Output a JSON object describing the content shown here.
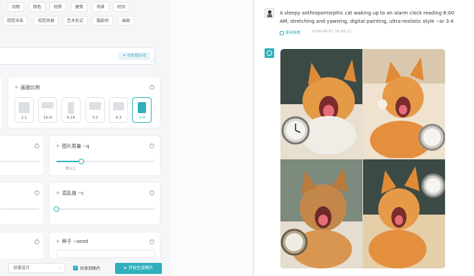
{
  "left": {
    "tag_rows": [
      [
        "动物",
        "颜色",
        "材质",
        "建筑",
        "场景",
        "时间"
      ],
      [
        "视觉冲击",
        "视觉风格",
        "艺术形式",
        "摄影师",
        "画家"
      ]
    ],
    "prompt_input": {
      "value": "",
      "optimize_label": "✦ 优化提示词"
    },
    "aspect_ratio": {
      "title": "画面比例",
      "options": [
        "1:1",
        "16:9",
        "9:16",
        "3:2",
        "4:3",
        "3:4"
      ],
      "selected": "3:4"
    },
    "quality": {
      "title": "图片质量 --q",
      "default_label": "默认1",
      "value": 0.25
    },
    "chaos": {
      "title": "混乱值 --c",
      "value": 0
    },
    "seed": {
      "title": "种子 --seed",
      "value": ""
    },
    "bottom": {
      "select_value": "动漫设计",
      "share_label": "共享到图片",
      "generate_label": "开始生成图片"
    }
  },
  "right": {
    "user_prompt": "A sleepy anthropomorphic cat waking up to an alarm clock reading 6:00 AM, stretching and yawning, digital painting, ultra-realistic style --ar 3:4",
    "use_params_label": "使用参数",
    "timestamp": "2024-08-07 10:56:22",
    "accent_color": "#2fb0bc"
  }
}
